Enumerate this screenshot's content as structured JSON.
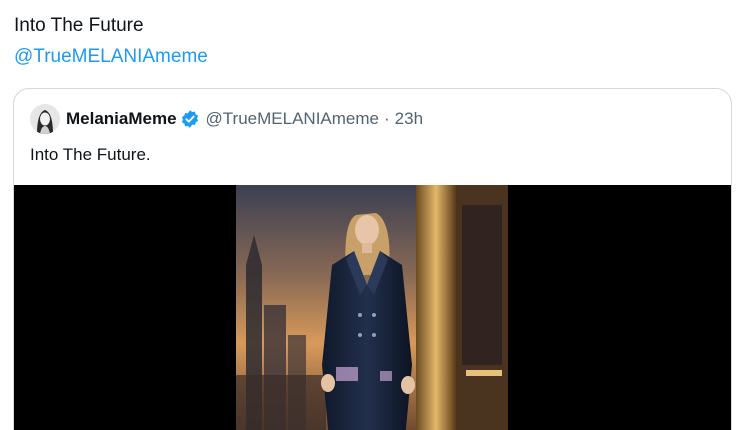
{
  "post": {
    "text": "Into The Future",
    "link": "@TrueMELANIAmeme"
  },
  "quote": {
    "author_name": "MelaniaMeme",
    "verified_icon": "verified-badge-icon",
    "author_handle": "@TrueMELANIAmeme",
    "separator": "·",
    "time": "23h",
    "text": "Into The Future."
  },
  "colors": {
    "link": "#1d9bf0",
    "verified": "#1d9bf0",
    "muted": "#536471",
    "border": "#cfd9de",
    "media_background": "#000000"
  }
}
